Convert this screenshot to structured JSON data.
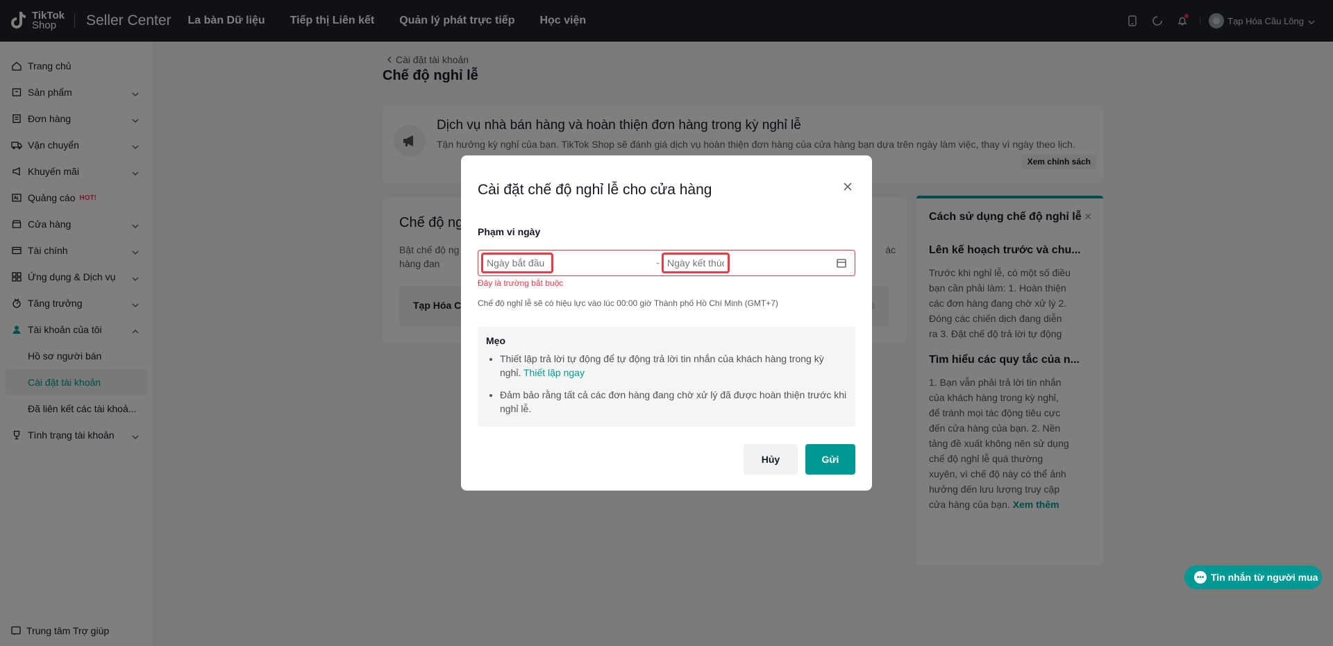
{
  "header": {
    "logo_line1": "TikTok",
    "logo_line2": "Shop",
    "brand": "Seller Center",
    "nav": [
      "La bàn Dữ liệu",
      "Tiếp thị Liên kết",
      "Quản lý phát trực tiếp",
      "Học viện"
    ],
    "store_name": "Tạp Hóa Cầu Lông"
  },
  "sidebar": {
    "items": [
      {
        "label": "Trang chủ",
        "icon": "home-icon"
      },
      {
        "label": "Sản phẩm",
        "icon": "product-icon"
      },
      {
        "label": "Đơn hàng",
        "icon": "order-icon"
      },
      {
        "label": "Vận chuyển",
        "icon": "truck-icon"
      },
      {
        "label": "Khuyến mãi",
        "icon": "promo-icon"
      },
      {
        "label": "Quảng cáo",
        "icon": "ads-icon",
        "badge": "HOT!"
      },
      {
        "label": "Cửa hàng",
        "icon": "store-icon"
      },
      {
        "label": "Tài chính",
        "icon": "finance-icon"
      },
      {
        "label": "Ứng dụng & Dịch vụ",
        "icon": "apps-icon"
      },
      {
        "label": "Tăng trưởng",
        "icon": "growth-icon"
      },
      {
        "label": "Tài khoản của tôi",
        "icon": "user-icon"
      },
      {
        "label": "Tình trạng tài khoản",
        "icon": "trophy-icon"
      }
    ],
    "sub_items": [
      "Hồ sơ người bán",
      "Cài đặt tài khoản",
      "Đã liên kết các tài khoả..."
    ],
    "help": "Trung tâm Trợ giúp"
  },
  "page": {
    "breadcrumb": "Cài đặt tài khoản",
    "title": "Chế độ nghỉ lễ",
    "banner_title": "Dịch vụ nhà bán hàng và hoàn thiện đơn hàng trong kỳ nghỉ lễ",
    "banner_desc": "Tận hưởng kỳ nghỉ của bạn. TikTok Shop sẽ đánh giá dịch vụ hoàn thiện đơn hàng của cửa hàng bạn dựa trên ngày làm việc, thay vì ngày theo lịch.",
    "policy_button": "Xem chính sách",
    "section_title": "Chế độ ng",
    "section_desc": "Bật chế độ ng đơn hàng đan",
    "section_desc_right": "ác",
    "store_row": "Tạp Hóa C"
  },
  "guide": {
    "title": "Cách sử dụng chế độ nghỉ lễ",
    "h1": "Lên kế hoạch trước và chu...",
    "p1": "Trước khi nghỉ lễ, có một số điều bạn cần phải làm: 1. Hoàn thiện các đơn hàng đang chờ xử lý 2. Đóng các chiến dịch đang diễn ra 3. Đặt chế độ trả lời tự động",
    "h2": "Tìm hiểu các quy tắc của n...",
    "p2": "1. Bạn vẫn phải trả lời tin nhắn của khách hàng trong kỳ nghỉ, để tránh mọi tác động tiêu cực đến cửa hàng của bạn. 2. Nền tảng đề xuất không nên sử dụng chế độ nghỉ lễ quá thường xuyên, vì chế độ này có thể ảnh hưởng đến lưu lượng truy cập cửa hàng của bạn.",
    "more": "Xem thêm"
  },
  "chat_button": "Tin nhắn từ người mua",
  "modal": {
    "title": "Cài đặt chế độ nghỉ lễ cho cửa hàng",
    "range_label": "Phạm vi ngày",
    "start_placeholder": "Ngày bắt đầu",
    "end_placeholder": "Ngày kết thúc",
    "dash": "-",
    "error": "Đây là trường bắt buộc",
    "note": "Chế độ nghỉ lễ sẽ có hiệu lực vào lúc 00:00 giờ Thành phố Hồ Chí Minh (GMT+7)",
    "tips_title": "Mẹo",
    "tip1": "Thiết lập trả lời tự động để tự động trả lời tin nhắn của khách hàng trong kỳ nghỉ.",
    "tip1_link": "Thiết lập ngay",
    "tip2": "Đảm bảo rằng tất cả các đơn hàng đang chờ xử lý đã được hoàn thiện trước khi nghỉ lễ.",
    "cancel": "Hủy",
    "send": "Gửi"
  },
  "colors": {
    "accent": "#009995",
    "error": "#e63a45",
    "header_bg": "#1f2329"
  }
}
